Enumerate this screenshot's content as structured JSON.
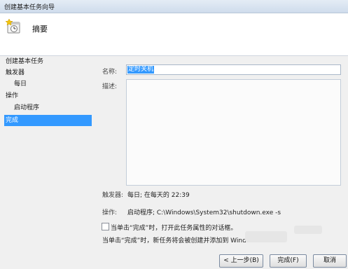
{
  "window": {
    "title": "创建基本任务向导"
  },
  "header": {
    "title": "摘要"
  },
  "sidebar": {
    "items": [
      {
        "label": "创建基本任务"
      },
      {
        "label": "触发器"
      },
      {
        "label": "每日"
      },
      {
        "label": "操作"
      },
      {
        "label": "启动程序"
      },
      {
        "label": "完成"
      }
    ]
  },
  "form": {
    "name_label": "名称:",
    "name_value": "定时关机",
    "desc_label": "描述:",
    "desc_value": ""
  },
  "summary": {
    "trigger_label": "触发器:",
    "trigger_value": "每日; 在每天的 22:39",
    "action_label": "操作:",
    "action_value": "启动程序; C:\\Windows\\System32\\shutdown.exe -s"
  },
  "options": {
    "checkbox_label": "当单击“完成”时，打开此任务属性的对话框。",
    "checkbox_checked": false,
    "note_text": "当单击“完成”时，新任务将会被创建并添加到 Wind"
  },
  "buttons": {
    "back": "< 上一步(B)",
    "finish": "完成(F)",
    "cancel": "取消"
  },
  "colors": {
    "selection": "#3399ff",
    "window_bg": "#f0f0f0"
  }
}
